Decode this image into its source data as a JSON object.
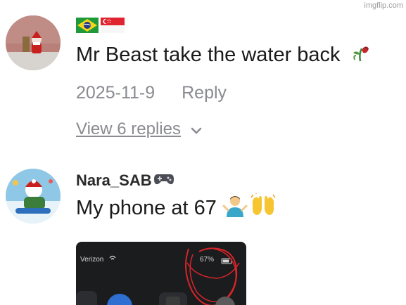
{
  "watermark": "imgflip.com",
  "comments": [
    {
      "username": "",
      "flags": [
        "brazil-flag",
        "singapore-flag"
      ],
      "text": "Mr Beast take the water back",
      "text_emoji": "wilted-rose-emoji",
      "date": "2025-11-9",
      "reply_label": "Reply",
      "view_replies": "View 6 replies"
    },
    {
      "username": "Nara_SAB",
      "username_emoji": "game-controller-emoji",
      "text": "My phone at 67",
      "text_emojis": [
        "person-shrugging-emoji",
        "raising-hands-emoji"
      ],
      "attachment": {
        "carrier": "Verizon",
        "battery": "67%"
      }
    }
  ],
  "colors": {
    "primary_text": "#1a1a1a",
    "secondary_text": "#8a8b91",
    "annotation_red": "#d6252a"
  }
}
